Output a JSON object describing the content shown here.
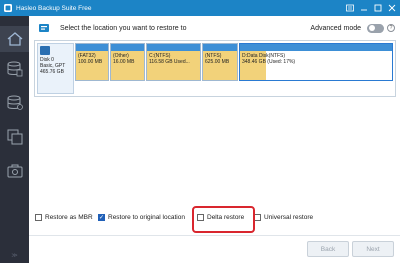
{
  "window": {
    "title": "Hasleo Backup Suite Free",
    "icon": "hasleo-logo-icon",
    "controls": [
      "menu-icon",
      "minimize-icon",
      "maximize-icon",
      "close-icon"
    ]
  },
  "sidebar": {
    "items": [
      {
        "icon": "home-icon",
        "active": true
      },
      {
        "icon": "backup-icon",
        "active": false
      },
      {
        "icon": "restore-icon",
        "active": false
      },
      {
        "icon": "clone-icon",
        "active": false
      },
      {
        "icon": "tools-icon",
        "active": false
      }
    ],
    "collapse_glyph": "≫"
  },
  "header": {
    "title": "Select the location you want to restore to",
    "advanced_mode_label": "Advanced mode",
    "advanced_mode_on": false,
    "help_label": "?"
  },
  "disk": {
    "name": "Disk 0",
    "type": "Basic, GPT",
    "size": "465.76 GB",
    "partitions": [
      {
        "label": "(FAT32)",
        "size": "100.00 MB",
        "used_fraction": 1.0
      },
      {
        "label": "(Other)",
        "size": "16.00 MB",
        "used_fraction": 1.0
      },
      {
        "label": "C:(NTFS)",
        "size": "116.58 GB Used...",
        "used_fraction": 1.0
      },
      {
        "label": "(NTFS)",
        "size": "625.00 MB",
        "used_fraction": 1.0
      },
      {
        "label": "D:Data Disk(NTFS)",
        "size": "348.46 GB (Used: 17%)",
        "used_fraction": 0.17,
        "selected": true
      }
    ]
  },
  "options": {
    "restore_as_mbr": {
      "label": "Restore as MBR",
      "checked": false
    },
    "restore_original": {
      "label": "Restore to original location",
      "checked": true
    },
    "delta_restore": {
      "label": "Delta restore",
      "checked": false
    },
    "universal_restore": {
      "label": "Universal restore",
      "checked": false
    }
  },
  "buttons": {
    "back": "Back",
    "next": "Next"
  },
  "colors": {
    "titlebar": "#1c84c6",
    "sidebar": "#2b2f3a",
    "highlight": "#d9262e",
    "partition_bar": "#3d8fd6",
    "used_fill": "#f2d27a"
  }
}
